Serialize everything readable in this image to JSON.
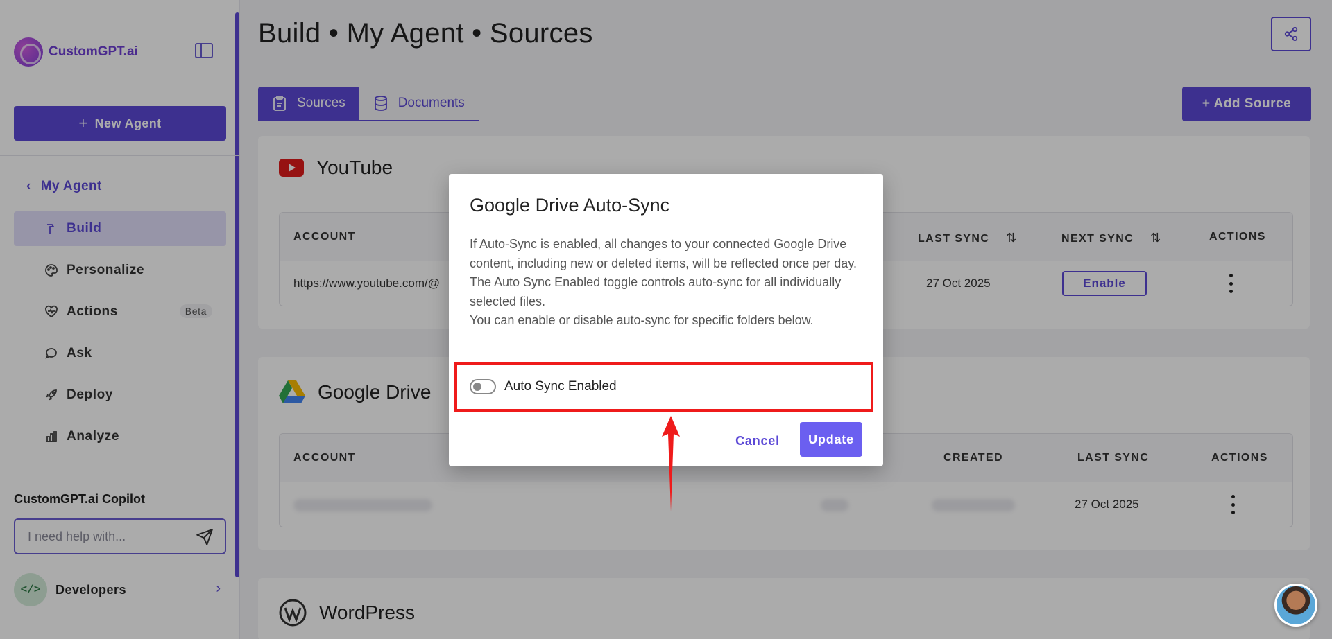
{
  "brand": {
    "name": "CustomGPT.ai"
  },
  "sidebar": {
    "new_agent_label": "New Agent",
    "back_label": "My Agent",
    "items": [
      {
        "label": "Build",
        "icon": "hammer-icon"
      },
      {
        "label": "Personalize",
        "icon": "palette-icon"
      },
      {
        "label": "Actions",
        "icon": "heart-pulse-icon",
        "badge": "Beta"
      },
      {
        "label": "Ask",
        "icon": "chat-bubble-icon"
      },
      {
        "label": "Deploy",
        "icon": "rocket-icon"
      },
      {
        "label": "Analyze",
        "icon": "bar-chart-icon"
      }
    ],
    "copilot_title": "CustomGPT.ai Copilot",
    "copilot_placeholder": "I need help with...",
    "developers_label": "Developers",
    "developers_icon_glyph": "</>"
  },
  "header": {
    "title": "Build • My Agent • Sources"
  },
  "tabs": [
    {
      "label": "Sources",
      "active": true
    },
    {
      "label": "Documents",
      "active": false
    }
  ],
  "add_source_label": "Add Source",
  "youtube": {
    "title": "YouTube",
    "columns": [
      "ACCOUNT",
      "LAST SYNC",
      "NEXT SYNC",
      "ACTIONS"
    ],
    "row": {
      "account": "https://www.youtube.com/@",
      "last_sync": "27 Oct 2025",
      "next_sync_button": "Enable"
    }
  },
  "google_drive": {
    "title": "Google Drive",
    "columns": [
      "ACCOUNT",
      "CREATED",
      "LAST SYNC",
      "ACTIONS"
    ],
    "row": {
      "last_sync": "27 Oct 2025"
    }
  },
  "wordpress": {
    "title": "WordPress"
  },
  "modal": {
    "title": "Google Drive Auto-Sync",
    "body_lines": [
      "If Auto-Sync is enabled, all changes to your connected Google Drive content, including new or deleted items, will be reflected once per day.",
      "The Auto Sync Enabled toggle controls auto-sync for all individually selected files.",
      "You can enable or disable auto-sync for specific folders below."
    ],
    "toggle_label": "Auto Sync Enabled",
    "toggle_on": false,
    "cancel_label": "Cancel",
    "update_label": "Update"
  },
  "colors": {
    "accent": "#5b48d6",
    "highlight": "#ef1b1b",
    "update_button": "#6b5ff0"
  }
}
